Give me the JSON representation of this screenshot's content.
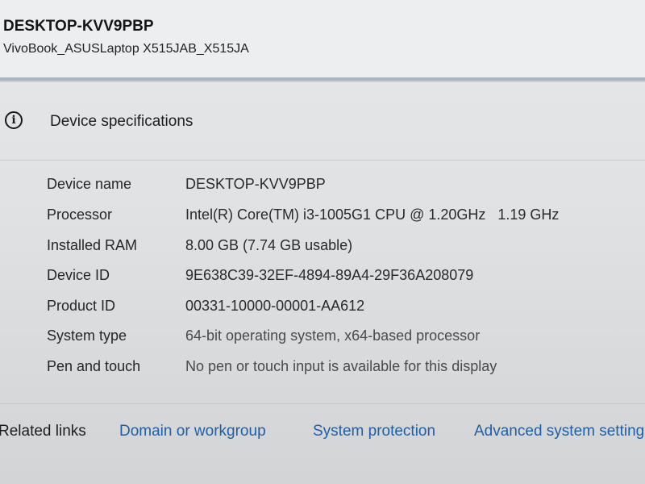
{
  "header": {
    "device_title": "DESKTOP-KVV9PBP",
    "device_model": "VivoBook_ASUSLaptop X515JAB_X515JA"
  },
  "section": {
    "icon": "info-icon",
    "icon_glyph": "i",
    "title": "Device specifications"
  },
  "specs": [
    {
      "label": "Device name",
      "value": "DESKTOP-KVV9PBP"
    },
    {
      "label": "Processor",
      "value": "Intel(R) Core(TM) i3-1005G1 CPU @ 1.20GHz   1.19 GHz"
    },
    {
      "label": "Installed RAM",
      "value": "8.00 GB (7.74 GB usable)"
    },
    {
      "label": "Device ID",
      "value": "9E638C39-32EF-4894-89A4-29F36A208079"
    },
    {
      "label": "Product ID",
      "value": "00331-10000-00001-AA612"
    },
    {
      "label": "System type",
      "value": "64-bit operating system, x64-based processor"
    },
    {
      "label": "Pen and touch",
      "value": "No pen or touch input is available for this display"
    }
  ],
  "related": {
    "label": "Related links",
    "links": [
      {
        "text": "Domain or workgroup"
      },
      {
        "text": "System protection"
      },
      {
        "text": "Advanced system setting"
      }
    ]
  },
  "colors": {
    "link": "#1d5fa8",
    "divider": "#a9b4be"
  }
}
